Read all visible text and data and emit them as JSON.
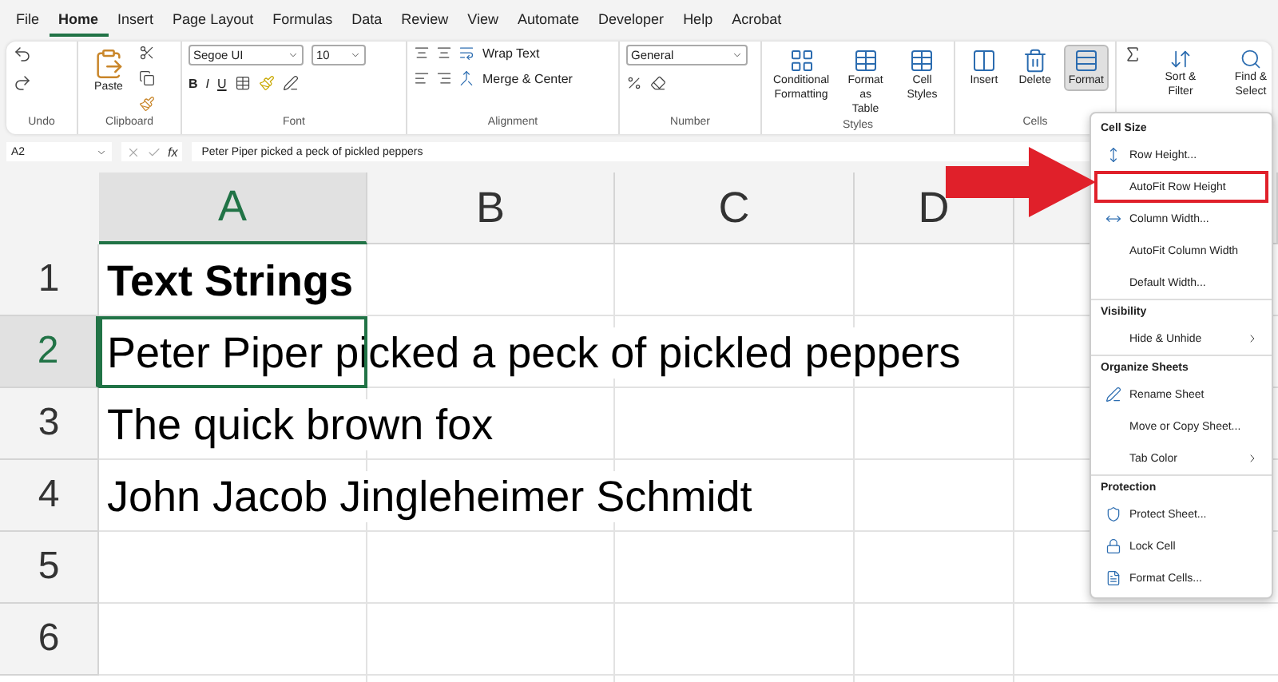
{
  "tabs": [
    {
      "label": "File",
      "selected": false
    },
    {
      "label": "Home",
      "selected": true
    },
    {
      "label": "Insert",
      "selected": false
    },
    {
      "label": "Page Layout",
      "selected": false
    },
    {
      "label": "Formulas",
      "selected": false
    },
    {
      "label": "Data",
      "selected": false
    },
    {
      "label": "Review",
      "selected": false
    },
    {
      "label": "View",
      "selected": false
    },
    {
      "label": "Automate",
      "selected": false
    },
    {
      "label": "Developer",
      "selected": false
    },
    {
      "label": "Help",
      "selected": false
    },
    {
      "label": "Acrobat",
      "selected": false
    }
  ],
  "ribbon": {
    "undo": {
      "label": "Undo"
    },
    "clipboard": {
      "label": "Clipboard",
      "paste": "Paste"
    },
    "font": {
      "label": "Font",
      "font_name": "Segoe UI",
      "font_size": "10",
      "bold": "B",
      "italic": "I",
      "underline": "U"
    },
    "alignment": {
      "label": "Alignment",
      "wrap": "Wrap Text",
      "merge": "Merge & Center"
    },
    "number": {
      "label": "Number",
      "format": "General"
    },
    "styles": {
      "label": "Styles",
      "buttons": [
        {
          "label": "Conditional Formatting"
        },
        {
          "label": "Format as Table"
        },
        {
          "label": "Cell Styles"
        }
      ]
    },
    "cells": {
      "label": "Cells",
      "buttons": [
        {
          "label": "Insert",
          "selected": false
        },
        {
          "label": "Delete",
          "selected": false
        },
        {
          "label": "Format",
          "selected": true
        }
      ]
    },
    "editing": {
      "buttons": [
        {
          "label": "Sort & Filter"
        },
        {
          "label": "Find & Select"
        }
      ]
    }
  },
  "formula_bar": {
    "name_box": "A2",
    "fx": "fx",
    "formula": "Peter Piper picked a peck of pickled peppers"
  },
  "columns": [
    {
      "label": "A",
      "selected": true
    },
    {
      "label": "B",
      "selected": false
    },
    {
      "label": "C",
      "selected": false
    },
    {
      "label": "D",
      "selected": false
    }
  ],
  "rows": [
    {
      "number": "1",
      "selected": false,
      "text": "Text Strings",
      "bold": true
    },
    {
      "number": "2",
      "selected": true,
      "text": "Peter Piper picked a peck of pickled peppers",
      "bold": false
    },
    {
      "number": "3",
      "selected": false,
      "text": "The quick brown fox",
      "bold": false
    },
    {
      "number": "4",
      "selected": false,
      "text": "John Jacob Jingleheimer Schmidt",
      "bold": false
    },
    {
      "number": "5",
      "selected": false
    },
    {
      "number": "6",
      "selected": false
    }
  ],
  "menu": {
    "sections": [
      {
        "title": "Cell Size",
        "items": [
          {
            "label": "Row Height...",
            "selected": false,
            "submenu": false
          },
          {
            "label": "AutoFit Row Height",
            "selected": true,
            "submenu": false
          },
          {
            "label": "Column Width...",
            "selected": false,
            "submenu": false
          },
          {
            "label": "AutoFit Column Width",
            "selected": false,
            "submenu": false
          },
          {
            "label": "Default Width...",
            "selected": false,
            "submenu": false
          }
        ]
      },
      {
        "title": "Visibility",
        "items": [
          {
            "label": "Hide & Unhide",
            "selected": false,
            "submenu": true
          }
        ]
      },
      {
        "title": "Organize Sheets",
        "items": [
          {
            "label": "Rename Sheet",
            "selected": false,
            "submenu": false
          },
          {
            "label": "Move or Copy Sheet...",
            "selected": false,
            "submenu": false
          },
          {
            "label": "Tab Color",
            "selected": false,
            "submenu": true
          }
        ]
      },
      {
        "title": "Protection",
        "items": [
          {
            "label": "Protect Sheet...",
            "selected": false,
            "submenu": false
          },
          {
            "label": "Lock Cell",
            "selected": false,
            "submenu": false
          },
          {
            "label": "Format Cells...",
            "selected": false,
            "submenu": false
          }
        ]
      }
    ]
  }
}
